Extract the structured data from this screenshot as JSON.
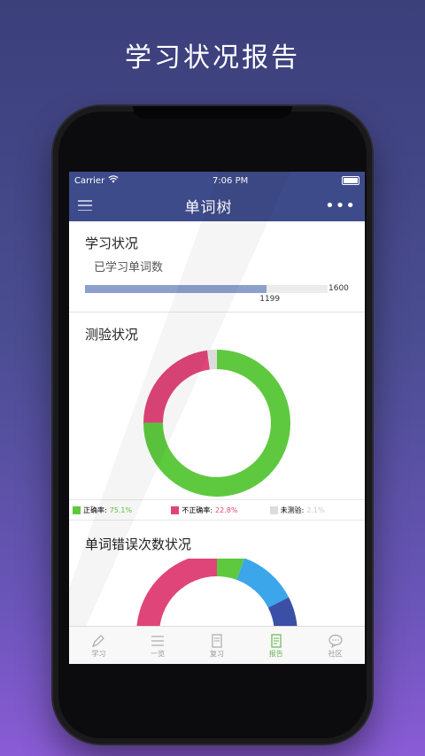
{
  "headline": "学习状况报告",
  "status_bar": {
    "carrier": "Carrier",
    "time": "7:06 PM"
  },
  "nav": {
    "title": "单词树"
  },
  "study": {
    "title": "学习状况",
    "subtitle": "已学习单词数",
    "learned": "1199",
    "total": "1600",
    "progress_fraction": 0.749
  },
  "quiz": {
    "title": "测验状况",
    "legend": [
      {
        "label": "正确率:",
        "value": "75.1%",
        "color": "#5ec93f"
      },
      {
        "label": "不正确率:",
        "value": "22.8%",
        "color": "#e0457a"
      },
      {
        "label": "未测验:",
        "value": "2.1%",
        "color": "#dcdcdc"
      }
    ]
  },
  "errors": {
    "title": "单词错误次数状况"
  },
  "tabs": [
    {
      "label": "学习",
      "icon": "pen-icon",
      "active": false
    },
    {
      "label": "一览",
      "icon": "list-icon",
      "active": false
    },
    {
      "label": "复习",
      "icon": "document-icon",
      "active": false
    },
    {
      "label": "报告",
      "icon": "report-icon",
      "active": true
    },
    {
      "label": "社区",
      "icon": "chat-bubble-icon",
      "active": false
    }
  ],
  "colors": {
    "nav_bg": "#3e4b8a",
    "correct": "#5ec93f",
    "incorrect": "#e0457a",
    "untested": "#dcdcdc",
    "progress": "#8da0cd",
    "accent_blue": "#3ba6ea",
    "accent_navy": "#3b4fa6"
  }
}
